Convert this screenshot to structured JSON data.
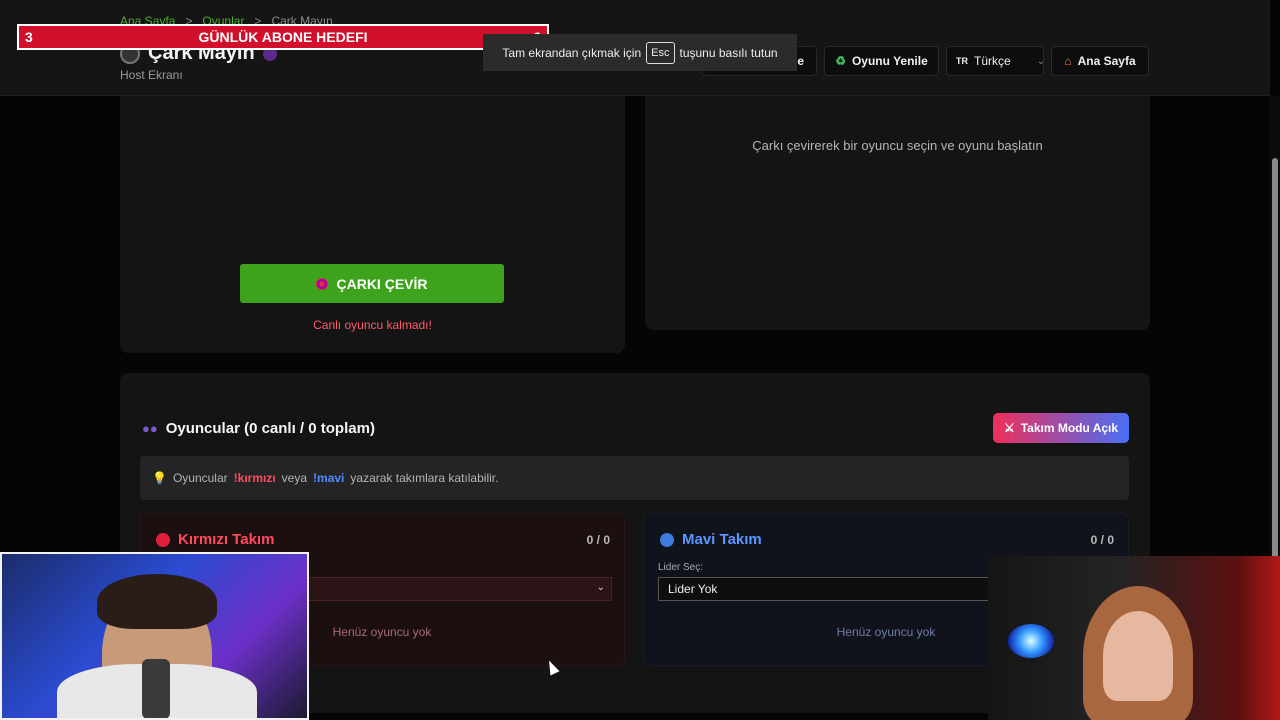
{
  "breadcrumb": {
    "home": "Ana Sayfa",
    "games": "Oyunlar",
    "current": "Çark Mayın",
    "sep": ">"
  },
  "header": {
    "title": "Çark Mayın",
    "subtitle": "Host Ekranı",
    "buttons": {
      "partial": "e",
      "refresh": "Oyunu Yenile",
      "language_code": "TR",
      "language": "Türkçe",
      "home": "Ana Sayfa"
    }
  },
  "overlay": {
    "goal_current": "3",
    "goal_title": "GÜNLÜK ABONE HEDEFI",
    "goal_target": "6"
  },
  "fullscreen_tip": {
    "before": "Tam ekrandan çıkmak için",
    "key": "Esc",
    "after": "tuşunu basılı tutun"
  },
  "wheel_panel": {
    "spin_label": "ÇARKI ÇEVİR",
    "warning": "Canlı oyuncu kalmadı!"
  },
  "info_panel": {
    "text": "Çarkı çevirerek bir oyuncu seçin ve oyunu başlatın"
  },
  "players": {
    "title": "Oyuncular (0 canlı / 0 toplam)",
    "team_mode_label": "Takım Modu Açık",
    "hint": {
      "before": "Oyuncular",
      "red": "!kırmızı",
      "mid": "veya",
      "blue": "!mavi",
      "after": "yazarak takımlara katılabilir."
    }
  },
  "teams": {
    "red": {
      "name": "Kırmızı Takım",
      "count": "0 / 0",
      "empty": "Henüz oyuncu yok"
    },
    "blue": {
      "name": "Mavi Takım",
      "count": "0 / 0",
      "leader_label": "Lider Seç:",
      "leader_value": "Lider Yok",
      "empty": "Henüz oyuncu yok"
    }
  },
  "colors": {
    "accent_green": "#3ea31c",
    "red": "#ff4a5e",
    "blue": "#5b96ff",
    "banner": "#d3102b"
  },
  "icons": [
    "crest-icon",
    "purple-dot-icon",
    "recycle-icon",
    "house-icon",
    "target-icon",
    "people-icon",
    "swords-icon",
    "lightbulb-icon",
    "red-ball-icon",
    "blue-ball-icon"
  ]
}
